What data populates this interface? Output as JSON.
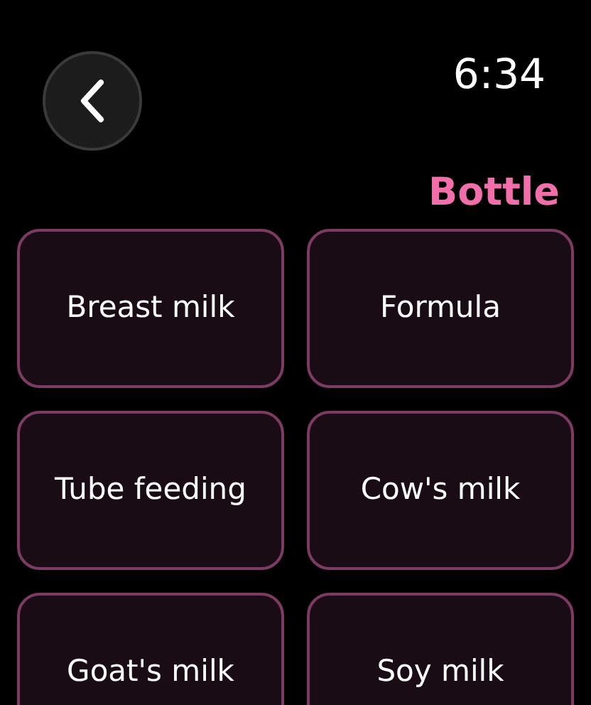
{
  "status_bar": {
    "time": "6:34"
  },
  "title": "Bottle",
  "options": [
    {
      "label": "Breast milk"
    },
    {
      "label": "Formula"
    },
    {
      "label": "Tube feeding"
    },
    {
      "label": "Cow's milk"
    },
    {
      "label": "Goat's milk"
    },
    {
      "label": "Soy milk"
    }
  ]
}
